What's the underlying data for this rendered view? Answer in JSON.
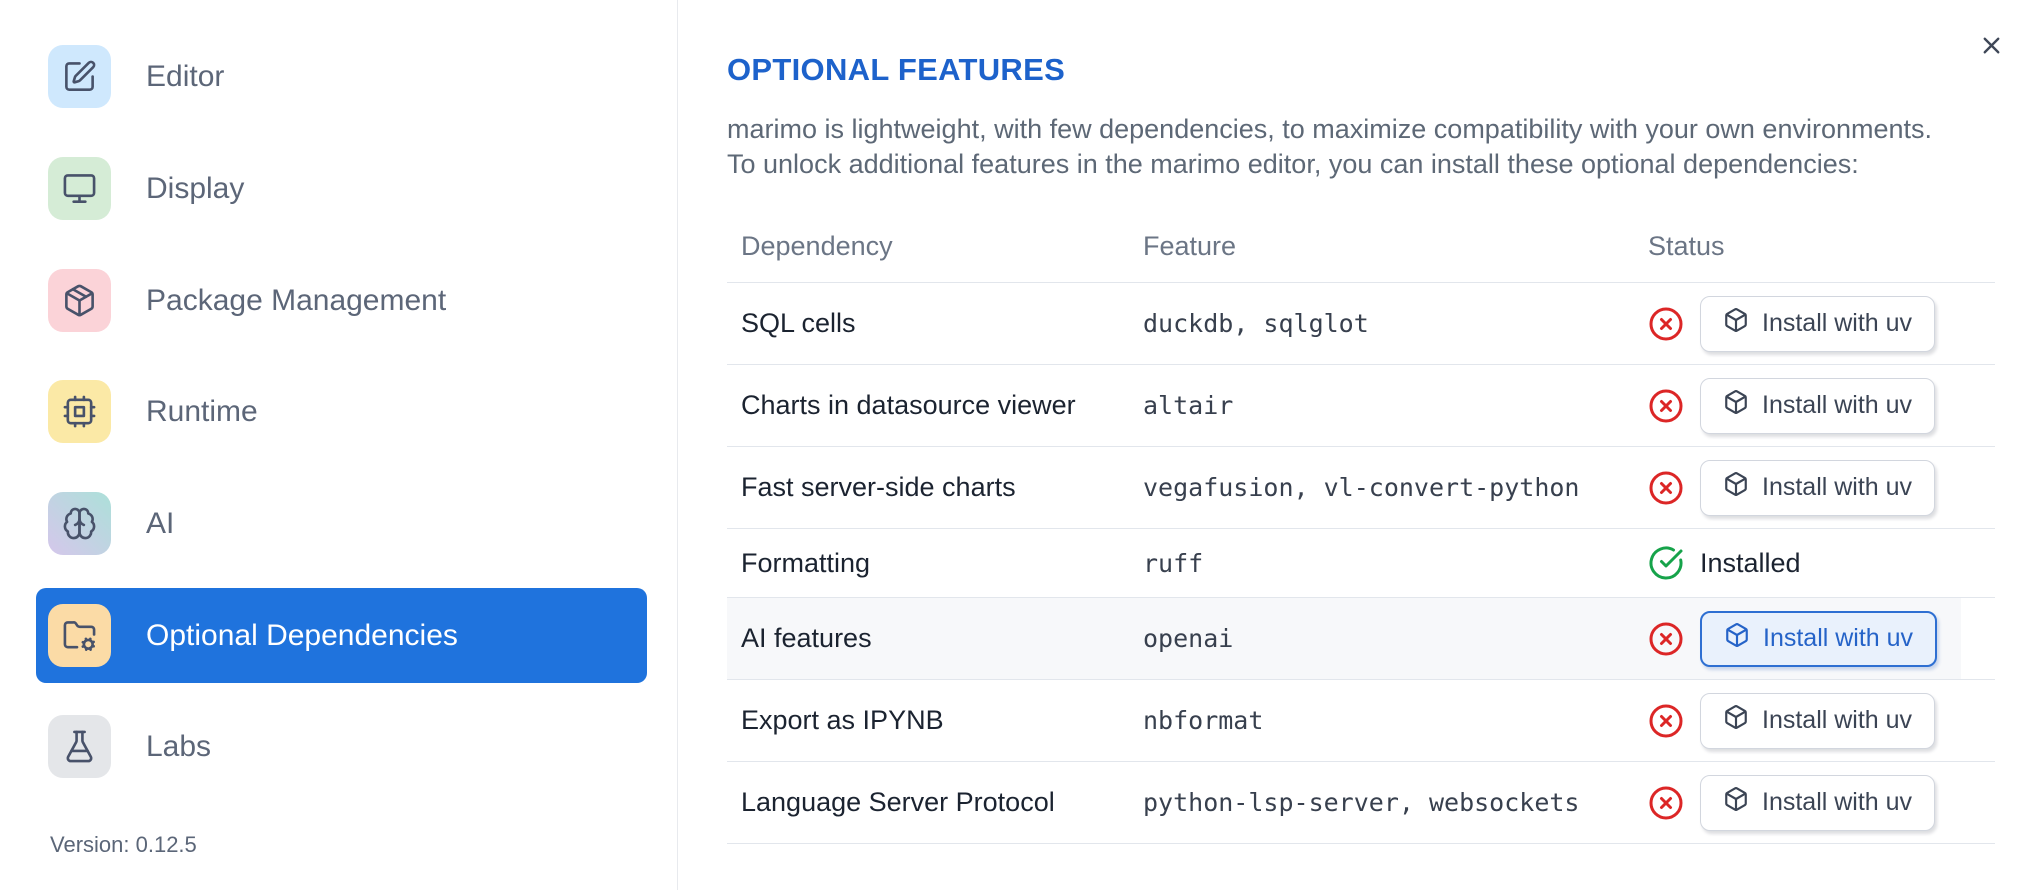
{
  "sidebar": {
    "items": [
      {
        "label": "Editor",
        "icon": "square-pen-icon",
        "selected": false
      },
      {
        "label": "Display",
        "icon": "monitor-icon",
        "selected": false
      },
      {
        "label": "Package Management",
        "icon": "package-icon",
        "selected": false
      },
      {
        "label": "Runtime",
        "icon": "cpu-icon",
        "selected": false
      },
      {
        "label": "AI",
        "icon": "brain-icon",
        "selected": false
      },
      {
        "label": "Optional Dependencies",
        "icon": "folder-cog-icon",
        "selected": true
      },
      {
        "label": "Labs",
        "icon": "flask-icon",
        "selected": false
      }
    ],
    "version_label": "Version: 0.12.5"
  },
  "panel": {
    "title": "OPTIONAL FEATURES",
    "description_line1": "marimo is lightweight, with few dependencies, to maximize compatibility with your own environments.",
    "description_line2": "To unlock additional features in the marimo editor, you can install these optional dependencies:"
  },
  "table": {
    "columns": [
      "Dependency",
      "Feature",
      "Status"
    ],
    "install_button_label": "Install with uv",
    "installed_label": "Installed",
    "rows": [
      {
        "dependency": "SQL cells",
        "feature": "duckdb, sqlglot",
        "status": "missing",
        "highlighted": false
      },
      {
        "dependency": "Charts in datasource viewer",
        "feature": "altair",
        "status": "missing",
        "highlighted": false
      },
      {
        "dependency": "Fast server-side charts",
        "feature": "vegafusion, vl-convert-python",
        "status": "missing",
        "highlighted": false
      },
      {
        "dependency": "Formatting",
        "feature": "ruff",
        "status": "installed",
        "highlighted": false
      },
      {
        "dependency": "AI features",
        "feature": "openai",
        "status": "missing",
        "highlighted": true
      },
      {
        "dependency": "Export as IPYNB",
        "feature": "nbformat",
        "status": "missing",
        "highlighted": false
      },
      {
        "dependency": "Language Server Protocol",
        "feature": "python-lsp-server, websockets",
        "status": "missing",
        "highlighted": false
      }
    ]
  },
  "colors": {
    "accent_blue": "#1d62cb",
    "sidebar_selected_bg": "#1f73dd",
    "error_red": "#dc2626",
    "success_green": "#16a34a"
  }
}
